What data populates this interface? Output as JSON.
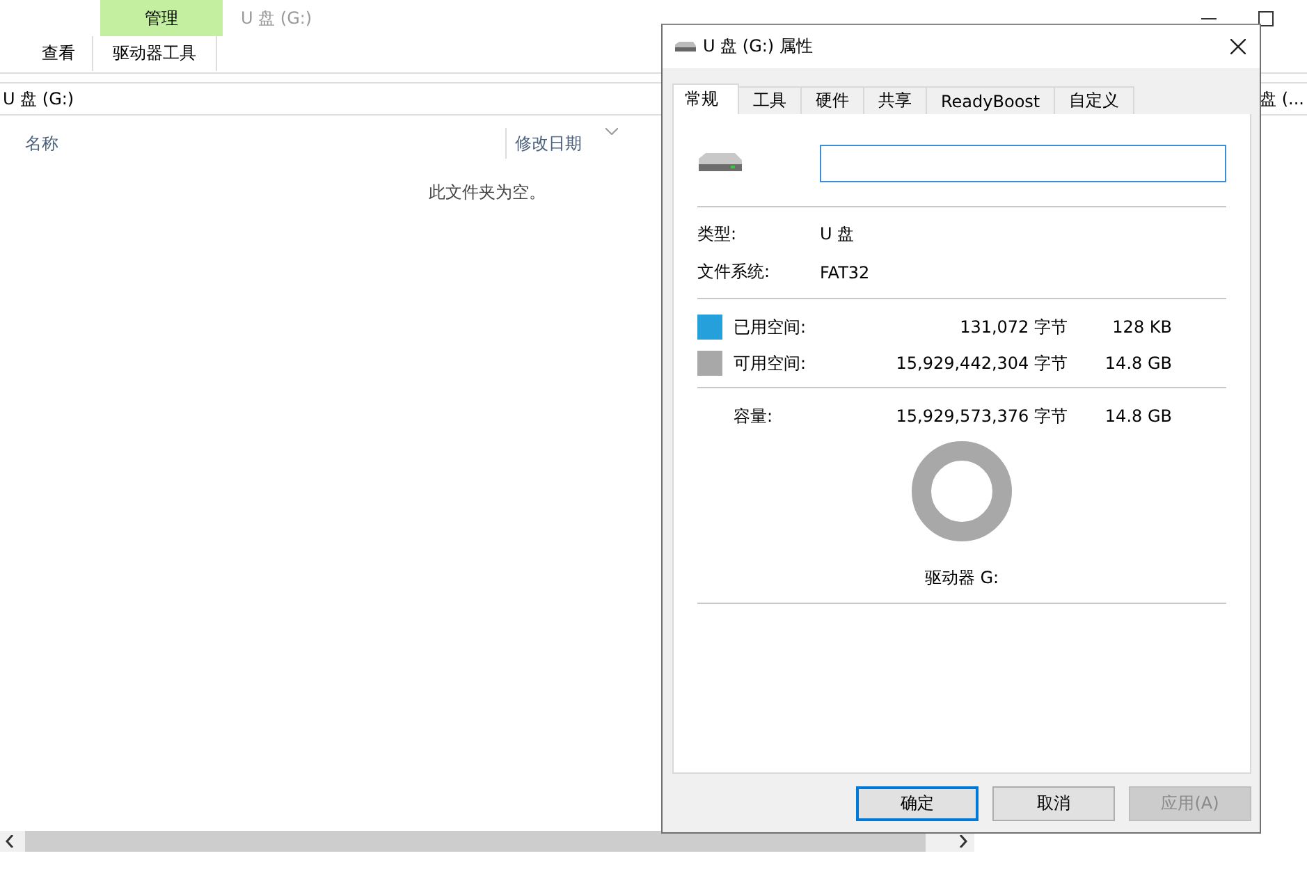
{
  "explorer": {
    "context_tab": "管理",
    "title": "U 盘 (G:)",
    "ribbon_tabs": [
      {
        "label": "查看",
        "selected": false
      },
      {
        "label": "驱动器工具",
        "selected": true
      }
    ],
    "address": "U 盘 (G:)",
    "search_hint": "盘 (...",
    "columns": [
      "名称",
      "修改日期"
    ],
    "empty_message": "此文件夹为空。"
  },
  "dialog": {
    "title": "U 盘 (G:) 属性",
    "tabs": [
      {
        "label": "常规",
        "selected": true
      },
      {
        "label": "工具",
        "selected": false
      },
      {
        "label": "硬件",
        "selected": false
      },
      {
        "label": "共享",
        "selected": false
      },
      {
        "label": "ReadyBoost",
        "selected": false
      },
      {
        "label": "自定义",
        "selected": false
      }
    ],
    "info": [
      {
        "label": "类型:",
        "value": "U 盘"
      },
      {
        "label": "文件系统:",
        "value": "FAT32"
      }
    ],
    "space": [
      {
        "label": "已用空间:",
        "bytes": "131,072 字节",
        "size": "128 KB",
        "color": "#26a0da"
      },
      {
        "label": "可用空间:",
        "bytes": "15,929,442,304 字节",
        "size": "14.8 GB",
        "color": "#a8a8a8"
      }
    ],
    "capacity": {
      "label": "容量:",
      "bytes": "15,929,573,376 字节",
      "size": "14.8 GB"
    },
    "drive_label": "驱动器 G:",
    "buttons": [
      {
        "label": "确定",
        "default": true,
        "disabled": false
      },
      {
        "label": "取消",
        "default": false,
        "disabled": false
      },
      {
        "label": "应用(A)",
        "default": false,
        "disabled": true
      }
    ]
  }
}
